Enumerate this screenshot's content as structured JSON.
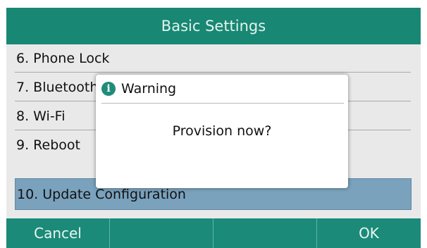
{
  "header": {
    "title": "Basic Settings"
  },
  "menu": {
    "items": [
      {
        "label": "6. Phone Lock"
      },
      {
        "label": "7. Bluetooth"
      },
      {
        "label": "8. Wi-Fi"
      },
      {
        "label": "9. Reboot"
      },
      {
        "label": "10. Update Configuration",
        "selected": true
      }
    ]
  },
  "dialog": {
    "title": "Warning",
    "icon": "info-icon",
    "message": "Provision now?"
  },
  "softkeys": [
    {
      "label": "Cancel"
    },
    {
      "label": ""
    },
    {
      "label": ""
    },
    {
      "label": "OK"
    }
  ],
  "colors": {
    "header": "#188773",
    "selection": "#7aa2bd",
    "softkey_bar": "#1b8a78"
  }
}
